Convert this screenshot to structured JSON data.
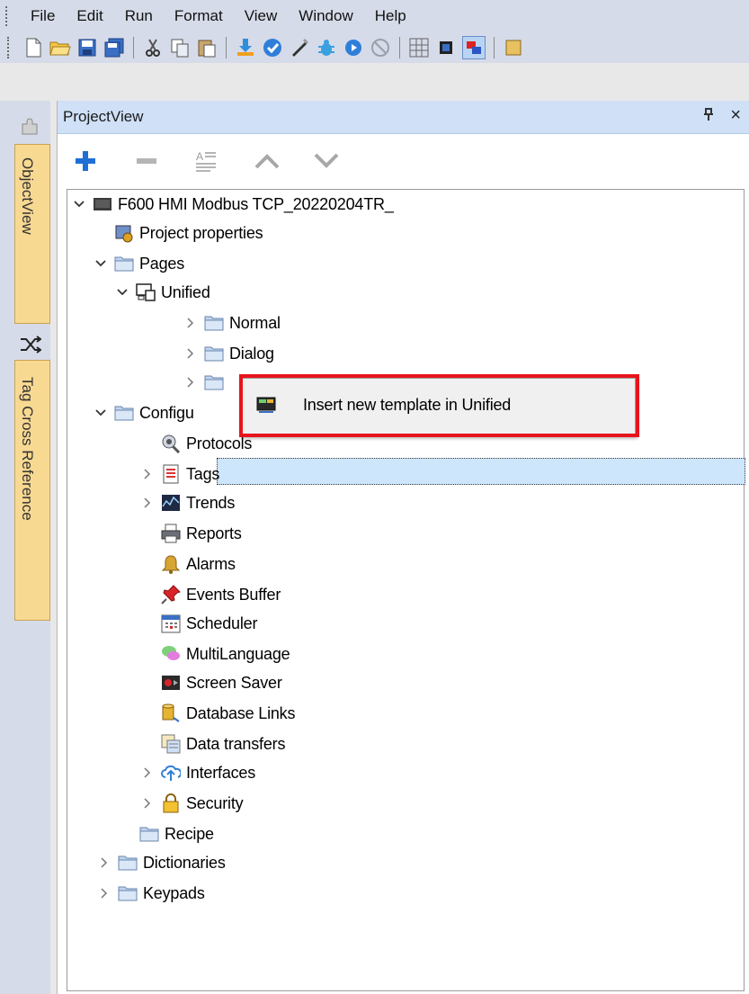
{
  "menubar": {
    "items": [
      "File",
      "Edit",
      "Run",
      "Format",
      "View",
      "Window",
      "Help"
    ]
  },
  "toolbar": {
    "buttons": [
      "new-icon",
      "open-icon",
      "save-icon",
      "save-all-icon",
      "cut-icon",
      "copy-icon",
      "paste-icon",
      "download-icon",
      "check-icon",
      "compile-icon",
      "debug-icon",
      "play-icon",
      "stop-icon",
      "grid-icon",
      "align-icon",
      "layout-icon",
      "settings-icon"
    ]
  },
  "sidebar": {
    "tabs": [
      {
        "label": "ObjectView",
        "icon": "puzzle-icon"
      },
      {
        "label": "Tag Cross Reference",
        "icon": "shuffle-icon"
      }
    ]
  },
  "panel": {
    "title": "ProjectView",
    "pin": "ᵖ",
    "close": "×",
    "toolbar": [
      "add-icon",
      "remove-icon",
      "rename-icon",
      "move-up-icon",
      "move-down-icon"
    ]
  },
  "tree": {
    "root": "F600 HMI Modbus TCP_20220204TR_",
    "project_properties": "Project properties",
    "pages": "Pages",
    "unified": "Unified",
    "normal": "Normal",
    "dialog": "Dialog",
    "config": "Configu",
    "protocols": "Protocols",
    "tags": "Tags",
    "trends": "Trends",
    "reports": "Reports",
    "alarms": "Alarms",
    "events": "Events Buffer",
    "scheduler": "Scheduler",
    "multilang": "MultiLanguage",
    "screensaver": "Screen Saver",
    "dblinks": "Database Links",
    "datatransfers": "Data transfers",
    "interfaces": "Interfaces",
    "security": "Security",
    "recipe": "Recipe",
    "dictionaries": "Dictionaries",
    "keypads": "Keypads"
  },
  "context_menu": {
    "item": "Insert new template in Unified"
  },
  "colors": {
    "highlight": "#e8141b",
    "selection": "#cde6fb",
    "panel_title": "#cfe0f7"
  }
}
